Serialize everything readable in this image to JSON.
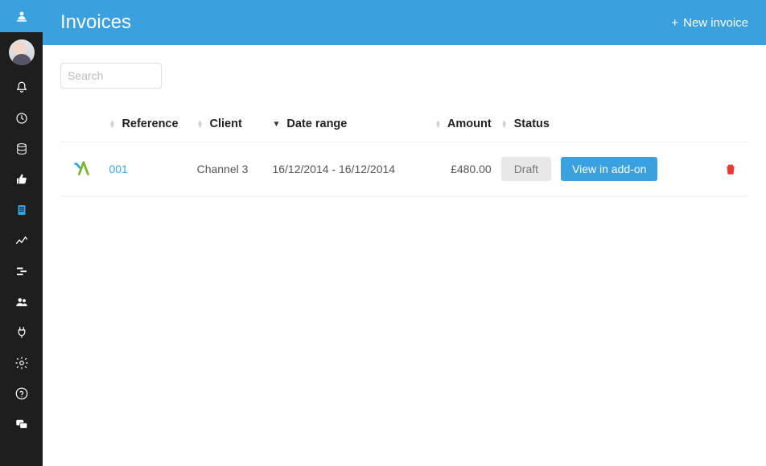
{
  "header": {
    "title": "Invoices",
    "new_invoice_label": "New invoice"
  },
  "search": {
    "placeholder": "Search"
  },
  "columns": {
    "reference": "Reference",
    "client": "Client",
    "date_range": "Date range",
    "amount": "Amount",
    "status": "Status"
  },
  "rows": [
    {
      "reference": "001",
      "client": "Channel 3",
      "date_range": "16/12/2014 - 16/12/2014",
      "amount": "£480.00",
      "status": "Draft",
      "action_label": "View in add-on"
    }
  ]
}
